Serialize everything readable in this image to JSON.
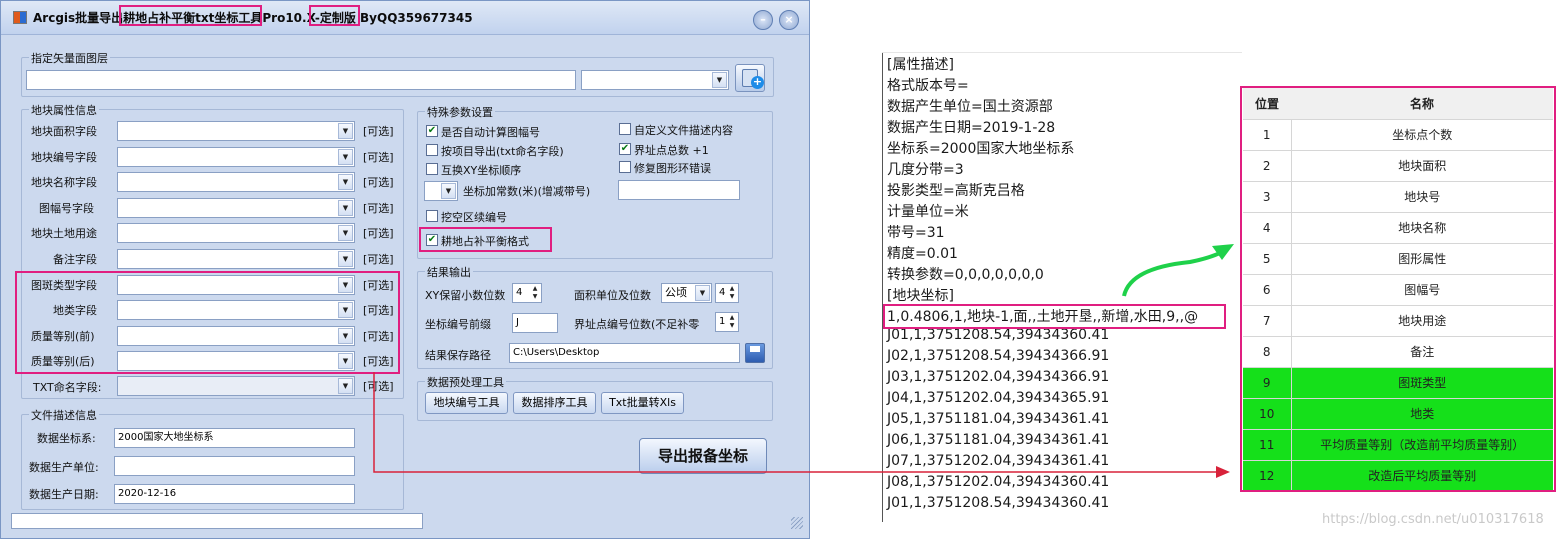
{
  "window": {
    "title": "Arcgis批量导出耕地占补平衡txt坐标工具Pro10.X-定制版 ByQQ359677345",
    "minimize_glyph": "–",
    "close_glyph": "×"
  },
  "layer_group": {
    "label": "指定矢量面图层",
    "layer_value": "",
    "type_value": ""
  },
  "attr_group": {
    "label": "地块属性信息",
    "optional_label": "[可选]",
    "fields": [
      {
        "label": "地块面积字段"
      },
      {
        "label": "地块编号字段"
      },
      {
        "label": "地块名称字段"
      },
      {
        "label": "图幅号字段"
      },
      {
        "label": "地块土地用途"
      },
      {
        "label": "备注字段"
      },
      {
        "label": "图斑类型字段"
      },
      {
        "label": "地类字段"
      },
      {
        "label": "质量等别(前)"
      },
      {
        "label": "质量等别(后)"
      },
      {
        "label": "TXT命名字段:"
      }
    ]
  },
  "special_group": {
    "label": "特殊参数设置",
    "auto_mapsheet": {
      "label": "是否自动计算图幅号",
      "checked": true
    },
    "export_by_item": {
      "label": "按项目导出(txt命名字段)",
      "checked": false
    },
    "swap_xy": {
      "label": "互换XY坐标顺序",
      "checked": false
    },
    "coord_add": {
      "label": "坐标加常数(米)(增减带号)",
      "value": ""
    },
    "hollow_numbering": {
      "label": "挖空区续编号",
      "checked": false
    },
    "balance_format": {
      "label": "耕地占补平衡格式",
      "checked": true
    },
    "custom_desc": {
      "label": "自定义文件描述内容",
      "checked": false
    },
    "boundary_total": {
      "label": "界址点总数 +1",
      "checked": true
    },
    "fix_ring": {
      "label": "修复图形环错误",
      "checked": false
    }
  },
  "file_group": {
    "label": "文件描述信息",
    "crs": {
      "label": "数据坐标系:",
      "value": "2000国家大地坐标系"
    },
    "producer": {
      "label": "数据生产单位:",
      "value": ""
    },
    "date": {
      "label": "数据生产日期:",
      "value": "2020-12-16"
    }
  },
  "output_group": {
    "label": "结果输出",
    "xy_decimals": {
      "label": "XY保留小数位数",
      "value": "4"
    },
    "area_unit": {
      "label": "面积单位及位数",
      "unit": "公顷",
      "digits": "4"
    },
    "coord_prefix": {
      "label": "坐标编号前缀",
      "value": "J"
    },
    "boundary_digits": {
      "label": "界址点编号位数(不足补零",
      "value": "1"
    },
    "save_path": {
      "label": "结果保存路径",
      "value": "C:\\Users\\Desktop"
    }
  },
  "preprocess_group": {
    "label": "数据预处理工具",
    "buttons": [
      "地块编号工具",
      "数据排序工具",
      "Txt批量转Xls"
    ]
  },
  "export_button": "导出报备坐标",
  "sample_text": [
    "[属性描述]",
    "格式版本号=",
    "数据产生单位=国土资源部",
    "数据产生日期=2019-1-28",
    "坐标系=2000国家大地坐标系",
    "几度分带=3",
    "投影类型=高斯克吕格",
    "计量单位=米",
    "带号=31",
    "精度=0.01",
    "转换参数=0,0,0,0,0,0,0",
    "[地块坐标]",
    "1,0.4806,1,地块-1,面,,土地开垦,,新增,水田,9,,@",
    "J01,1,3751208.54,39434360.41",
    "J02,1,3751208.54,39434366.91",
    "J03,1,3751202.04,39434366.91",
    "J04,1,3751202.04,39434365.91",
    "J05,1,3751181.04,39434361.41",
    "J06,1,3751181.04,39434361.41",
    "J07,1,3751202.04,39434361.41",
    "J08,1,3751202.04,39434360.41",
    "J01,1,3751208.54,39434360.41"
  ],
  "position_table": {
    "headers": [
      "位置",
      "名称"
    ],
    "rows": [
      [
        "1",
        "坐标点个数"
      ],
      [
        "2",
        "地块面积"
      ],
      [
        "3",
        "地块号"
      ],
      [
        "4",
        "地块名称"
      ],
      [
        "5",
        "图形属性"
      ],
      [
        "6",
        "图幅号"
      ],
      [
        "7",
        "地块用途"
      ],
      [
        "8",
        "备注"
      ],
      [
        "9",
        "图斑类型"
      ],
      [
        "10",
        "地类"
      ],
      [
        "11",
        "平均质量等别（改造前平均质量等别）"
      ],
      [
        "12",
        "改造后平均质量等别"
      ]
    ],
    "highlight_color": "#15e01a"
  },
  "watermark": "https://blog.csdn.net/u010317618",
  "colors": {
    "annotation": "#e01e80",
    "arrow_red": "#d8223a",
    "arrow_green": "#1fd14a"
  }
}
